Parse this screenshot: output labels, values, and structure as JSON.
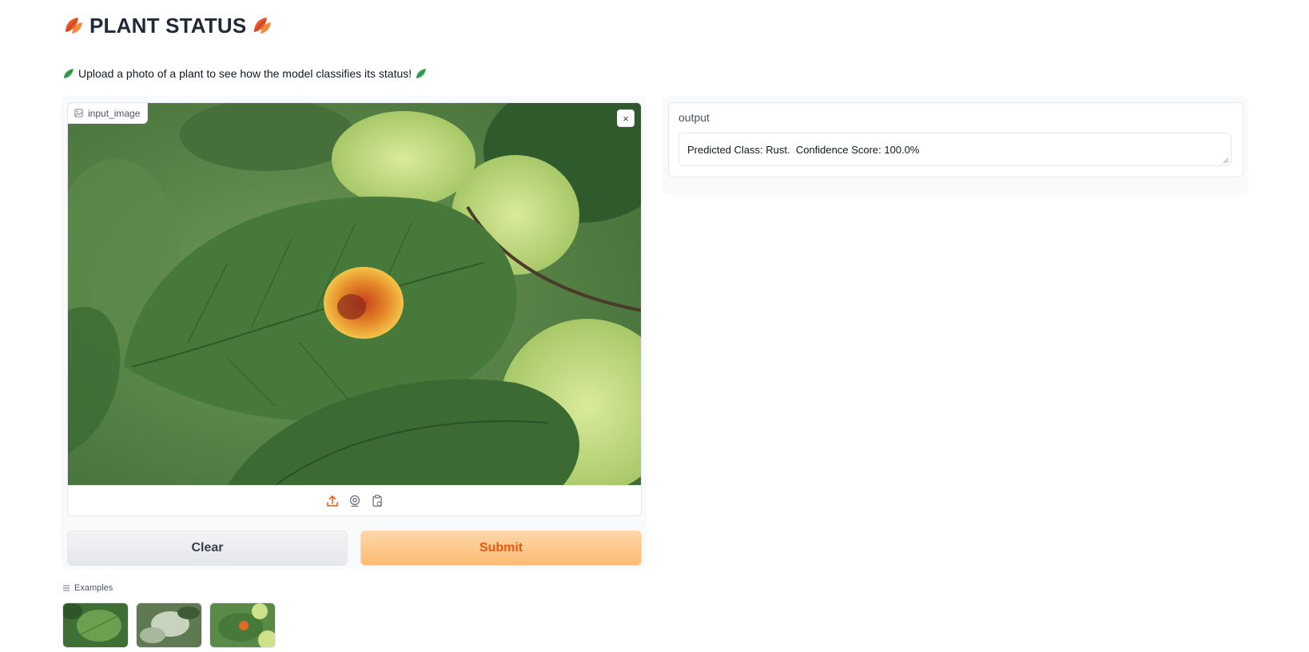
{
  "header": {
    "title": "PLANT STATUS",
    "title_icon": "fallen-leaf-emoji",
    "subtitle": "Upload a photo of a plant to see how the model classifies its status!",
    "subtitle_icon": "leafy-green-emoji"
  },
  "input": {
    "label": "input_image",
    "close_label": "×",
    "source_icons": [
      "upload-icon",
      "webcam-icon",
      "clipboard-icon"
    ]
  },
  "buttons": {
    "clear": "Clear",
    "submit": "Submit"
  },
  "output": {
    "label": "output",
    "value": "Predicted Class: Rust.  Confidence Score: 100.0%"
  },
  "examples": {
    "label": "Examples"
  },
  "colors": {
    "accent": "#ea580c",
    "submit_bg": "#fdba74",
    "panel_bg": "#f9fafb"
  }
}
